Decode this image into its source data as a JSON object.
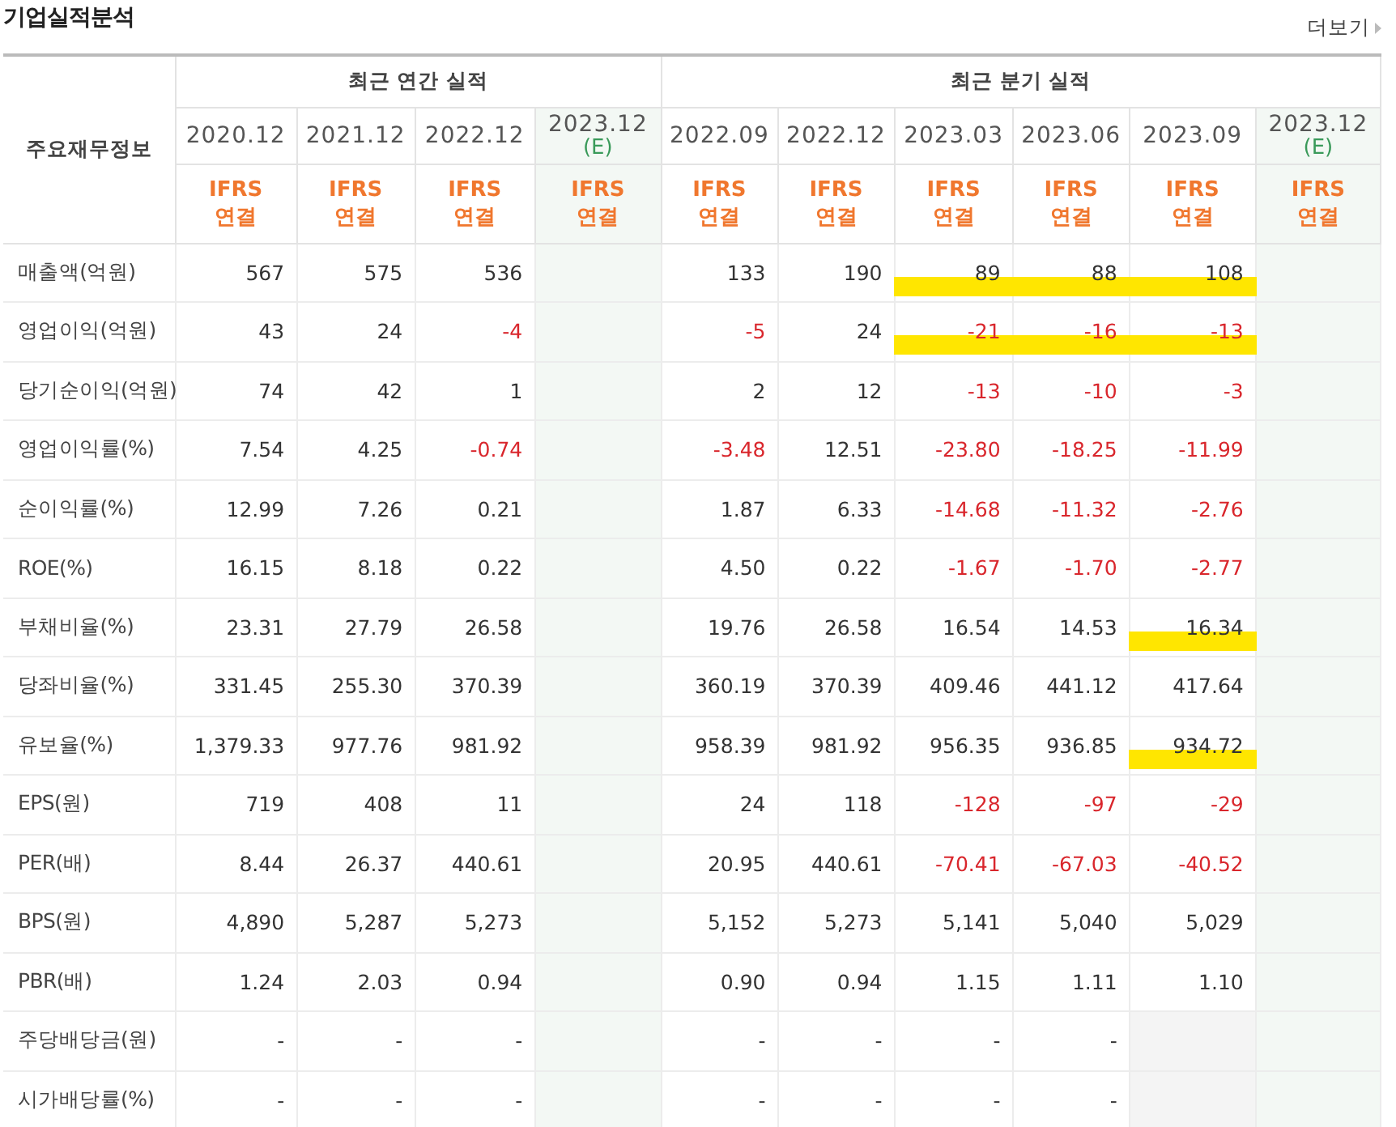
{
  "title": "기업실적분석",
  "more_link": "더보기",
  "corner_header": "주요재무정보",
  "period_groups": [
    {
      "label": "최근 연간 실적",
      "periods": [
        {
          "date": "2020.12",
          "estimate": false,
          "basis": [
            "IFRS",
            "연결"
          ]
        },
        {
          "date": "2021.12",
          "estimate": false,
          "basis": [
            "IFRS",
            "연결"
          ]
        },
        {
          "date": "2022.12",
          "estimate": false,
          "basis": [
            "IFRS",
            "연결"
          ]
        },
        {
          "date": "2023.12",
          "note": "(E)",
          "estimate": true,
          "basis": [
            "IFRS",
            "연결"
          ]
        }
      ]
    },
    {
      "label": "최근 분기 실적",
      "periods": [
        {
          "date": "2022.09",
          "estimate": false,
          "basis": [
            "IFRS",
            "연결"
          ]
        },
        {
          "date": "2022.12",
          "estimate": false,
          "basis": [
            "IFRS",
            "연결"
          ]
        },
        {
          "date": "2023.03",
          "estimate": false,
          "basis": [
            "IFRS",
            "연결"
          ]
        },
        {
          "date": "2023.06",
          "estimate": false,
          "basis": [
            "IFRS",
            "연결"
          ]
        },
        {
          "date": "2023.09",
          "estimate": false,
          "basis": [
            "IFRS",
            "연결"
          ]
        },
        {
          "date": "2023.12",
          "note": "(E)",
          "estimate": true,
          "basis": [
            "IFRS",
            "연결"
          ]
        }
      ]
    }
  ],
  "row_groups": [
    {
      "rows": [
        {
          "label": "매출액(억원)",
          "cells": [
            "567",
            "575",
            "536",
            "133",
            "190",
            {
              "text": "89",
              "highlighted": true
            },
            {
              "text": "88",
              "highlighted": true
            },
            {
              "text": "108",
              "highlighted": true
            }
          ]
        },
        {
          "label": "영업이익(억원)",
          "cells": [
            "43",
            "24",
            {
              "text": "-4",
              "negative": true
            },
            {
              "text": "-5",
              "negative": true
            },
            "24",
            {
              "text": "-21",
              "negative": true,
              "highlighted": true
            },
            {
              "text": "-16",
              "negative": true,
              "highlighted": true
            },
            {
              "text": "-13",
              "negative": true,
              "highlighted": true
            }
          ]
        },
        {
          "label": "당기순이익(억원)",
          "cells": [
            "74",
            "42",
            "1",
            "2",
            "12",
            {
              "text": "-13",
              "negative": true
            },
            {
              "text": "-10",
              "negative": true
            },
            {
              "text": "-3",
              "negative": true
            }
          ]
        }
      ]
    },
    {
      "rows": [
        {
          "label": "영업이익률(%)",
          "cells": [
            "7.54",
            "4.25",
            {
              "text": "-0.74",
              "negative": true
            },
            {
              "text": "-3.48",
              "negative": true
            },
            "12.51",
            {
              "text": "-23.80",
              "negative": true
            },
            {
              "text": "-18.25",
              "negative": true
            },
            {
              "text": "-11.99",
              "negative": true
            }
          ]
        },
        {
          "label": "순이익률(%)",
          "cells": [
            "12.99",
            "7.26",
            "0.21",
            "1.87",
            "6.33",
            {
              "text": "-14.68",
              "negative": true
            },
            {
              "text": "-11.32",
              "negative": true
            },
            {
              "text": "-2.76",
              "negative": true
            }
          ]
        },
        {
          "label": "ROE(%)",
          "cells": [
            "16.15",
            "8.18",
            "0.22",
            "4.50",
            "0.22",
            {
              "text": "-1.67",
              "negative": true
            },
            {
              "text": "-1.70",
              "negative": true
            },
            {
              "text": "-2.77",
              "negative": true
            }
          ]
        }
      ]
    },
    {
      "rows": [
        {
          "label": "부채비율(%)",
          "cells": [
            "23.31",
            "27.79",
            "26.58",
            "19.76",
            "26.58",
            "16.54",
            "14.53",
            {
              "text": "16.34",
              "highlighted": true
            }
          ]
        },
        {
          "label": "당좌비율(%)",
          "cells": [
            "331.45",
            "255.30",
            "370.39",
            "360.19",
            "370.39",
            "409.46",
            "441.12",
            "417.64"
          ]
        },
        {
          "label": "유보율(%)",
          "cells": [
            "1,379.33",
            "977.76",
            "981.92",
            "958.39",
            "981.92",
            "956.35",
            "936.85",
            {
              "text": "934.72",
              "highlighted": true
            }
          ]
        }
      ]
    },
    {
      "rows": [
        {
          "label": "EPS(원)",
          "cells": [
            "719",
            "408",
            "11",
            "24",
            "118",
            {
              "text": "-128",
              "negative": true
            },
            {
              "text": "-97",
              "negative": true
            },
            {
              "text": "-29",
              "negative": true
            }
          ]
        },
        {
          "label": "PER(배)",
          "cells": [
            "8.44",
            "26.37",
            "440.61",
            "20.95",
            "440.61",
            {
              "text": "-70.41",
              "negative": true
            },
            {
              "text": "-67.03",
              "negative": true
            },
            {
              "text": "-40.52",
              "negative": true
            }
          ]
        },
        {
          "label": "BPS(원)",
          "cells": [
            "4,890",
            "5,287",
            "5,273",
            "5,152",
            "5,273",
            "5,141",
            "5,040",
            "5,029"
          ]
        },
        {
          "label": "PBR(배)",
          "cells": [
            "1.24",
            "2.03",
            "0.94",
            "0.90",
            "0.94",
            "1.15",
            "1.11",
            "1.10"
          ]
        }
      ]
    },
    {
      "rows": [
        {
          "label": "주당배당금(원)",
          "cells": [
            "-",
            "-",
            "-",
            "-",
            "-",
            "-",
            "-",
            {
              "kind": "blank"
            }
          ]
        },
        {
          "label": "시가배당률(%)",
          "cells": [
            "-",
            "-",
            "-",
            "-",
            "-",
            "-",
            "-",
            {
              "kind": "blank"
            }
          ]
        }
      ]
    }
  ]
}
